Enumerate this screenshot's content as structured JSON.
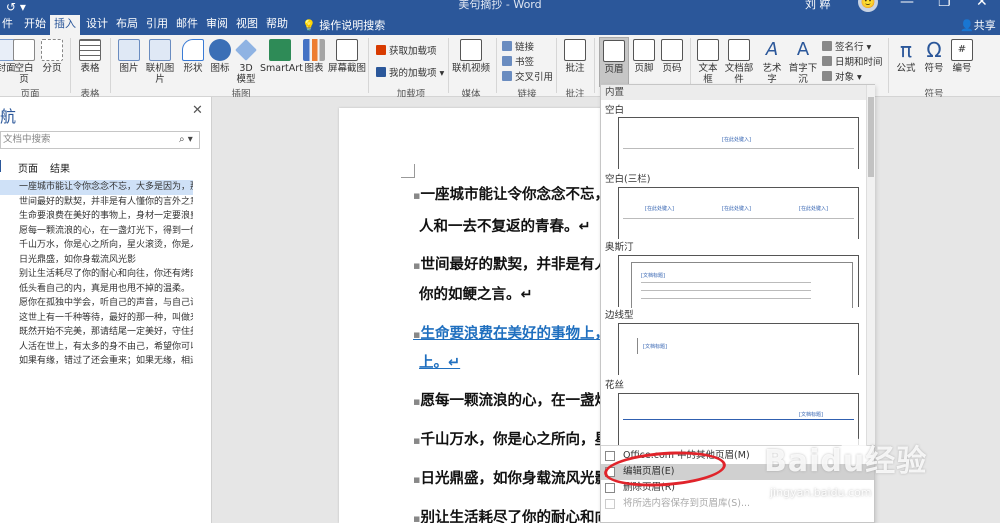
{
  "window": {
    "title": "美句摘抄 - Word",
    "user": "刘 粹",
    "avatar": "🙂",
    "minimize": "—",
    "restore": "❐",
    "close": "✕",
    "quick_access": "↺ ▾"
  },
  "tabs": [
    {
      "label": "开始"
    },
    {
      "label": "插入"
    },
    {
      "label": "设计"
    },
    {
      "label": "布局"
    },
    {
      "label": "引用"
    },
    {
      "label": "邮件"
    },
    {
      "label": "审阅"
    },
    {
      "label": "视图"
    },
    {
      "label": "帮助"
    }
  ],
  "tell_me": "操作说明搜索",
  "share": "共享",
  "ribbon": {
    "pages_group": {
      "cover": "封面",
      "blank": "空白页",
      "break": "分页",
      "label": "页面"
    },
    "tables_group": {
      "table": "表格",
      "label": "表格"
    },
    "illustrations_group": {
      "pictures": "图片",
      "online_pictures": "联机图片",
      "shapes": "形状",
      "icons": "图标",
      "model3d": "3D\n模型",
      "smartart": "SmartArt",
      "chart": "图表",
      "screenshot": "屏幕截图",
      "label": "插图"
    },
    "addins_group": {
      "get_addins": "获取加载项",
      "my_addins": "我的加载项",
      "label": "加载项"
    },
    "media_group": {
      "online_video": "联机视频",
      "label": "媒体"
    },
    "links_group": {
      "link": "链接",
      "bookmark": "书签",
      "crossref": "交叉引用",
      "label": "链接"
    },
    "comments_group": {
      "comment": "批注",
      "label": "批注"
    },
    "header_footer_group": {
      "header": "页眉",
      "footer": "页脚",
      "page_number": "页码"
    },
    "text_group": {
      "textbox": "文本框",
      "quickparts": "文档部件",
      "wordart": "艺术字",
      "dropcap": "首字下沉",
      "signature": "签名行",
      "datetime": "日期和时间",
      "object": "对象"
    },
    "symbols_group": {
      "equation": "公式",
      "symbol": "符号",
      "number": "编号",
      "label": "符号"
    }
  },
  "nav": {
    "title": "航",
    "search_placeholder": "文档中搜索",
    "tabs": [
      "页面",
      "结果"
    ],
    "items": [
      "一座城市能让令你念念不忘，大多是因为，那...",
      "世间最好的默契，并非是有人懂你的言外之意...",
      "生命要浪费在美好的事物上，身材一定要浪费...",
      "愿每一颗流浪的心，在一盏灯光下，得到一份...",
      "千山万水，你是心之所向，星火滚烫，你是人...",
      "日光鼎盛，如你身载流风光影",
      "别让生活耗尽了你的耐心和向往，你还有烤肉...",
      "低头看自己的内，真是用也甩不掉的温柔。",
      "愿你在孤独中学会，听自己的声音，与自己说...",
      "这世上有一千种等待，最好的那一种，叫做来...",
      "既然开始不完美，那请结尾一定美好，守住美...",
      "人活在世上，有太多的身不由己，希望你可以...",
      "如果有缘，错过了还会重来；如果无缘，相遇..."
    ]
  },
  "document": {
    "paragraphs": [
      "一座城市能让令你念念不忘，",
      "人和一去不复返的青春。↵",
      "世间最好的默契，并非是有人",
      "你的如鲠之言。↵",
      "生命要浪费在美好的事物上，",
      "上。↵",
      "愿每一颗流浪的心，在一盏灯",
      "千山万水，你是心之所向，星",
      "日光鼎盛，如你身载流风光影",
      "别让生活耗尽了你的耐心和向往，你还有烤肉和刷肥美烤烧"
    ]
  },
  "gallery": {
    "section": "内置",
    "items": [
      {
        "name": "空白",
        "placeholder": "[在此处键入]"
      },
      {
        "name": "空白(三栏)",
        "placeholder": "[在此处键入]"
      },
      {
        "name": "奥斯汀",
        "placeholder": "[文档标题]"
      },
      {
        "name": "边线型",
        "placeholder": "[文档标题]"
      },
      {
        "name": "花丝",
        "placeholder": "[文档标题]"
      }
    ],
    "menu": {
      "more": "Office.com 中的其他页眉(M)",
      "edit": "编辑页眉(E)",
      "remove": "删除页眉(R)",
      "save": "将所选内容保存到页眉库(S)..."
    }
  },
  "watermark": {
    "brand": "Baidu经验",
    "url": "jingyan.baidu.com"
  }
}
